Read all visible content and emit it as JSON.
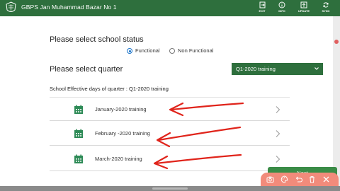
{
  "app": {
    "title": "GBPS Jan Muhammad Bazar No 1",
    "actions": [
      {
        "label": "EXIT",
        "icon": "exit-icon"
      },
      {
        "label": "INFO",
        "icon": "info-icon"
      },
      {
        "label": "UPDATE",
        "icon": "update-icon"
      },
      {
        "label": "SYNC",
        "icon": "sync-icon"
      }
    ]
  },
  "status": {
    "label": "Please select school status",
    "options": [
      "Functional",
      "Non Functional"
    ],
    "selected": "Functional"
  },
  "quarter": {
    "label": "Please select quarter",
    "selected": "Q1-2020 training"
  },
  "days": {
    "label": "School Effective days of quarter : Q1-2020 training"
  },
  "trainings": [
    {
      "label": "January-2020 training"
    },
    {
      "label": "February -2020 training"
    },
    {
      "label": "March-2020 training"
    }
  ],
  "next": {
    "label": "Next"
  },
  "screen_toolbar": {
    "icons": [
      "camera-icon",
      "palette-icon",
      "undo-icon",
      "trash-icon",
      "close-icon"
    ]
  },
  "colors": {
    "appbar": "#2e6f3d",
    "accent": "#1a73c9",
    "annotation": "#e0241b",
    "toolbar": "#f28b7b"
  }
}
